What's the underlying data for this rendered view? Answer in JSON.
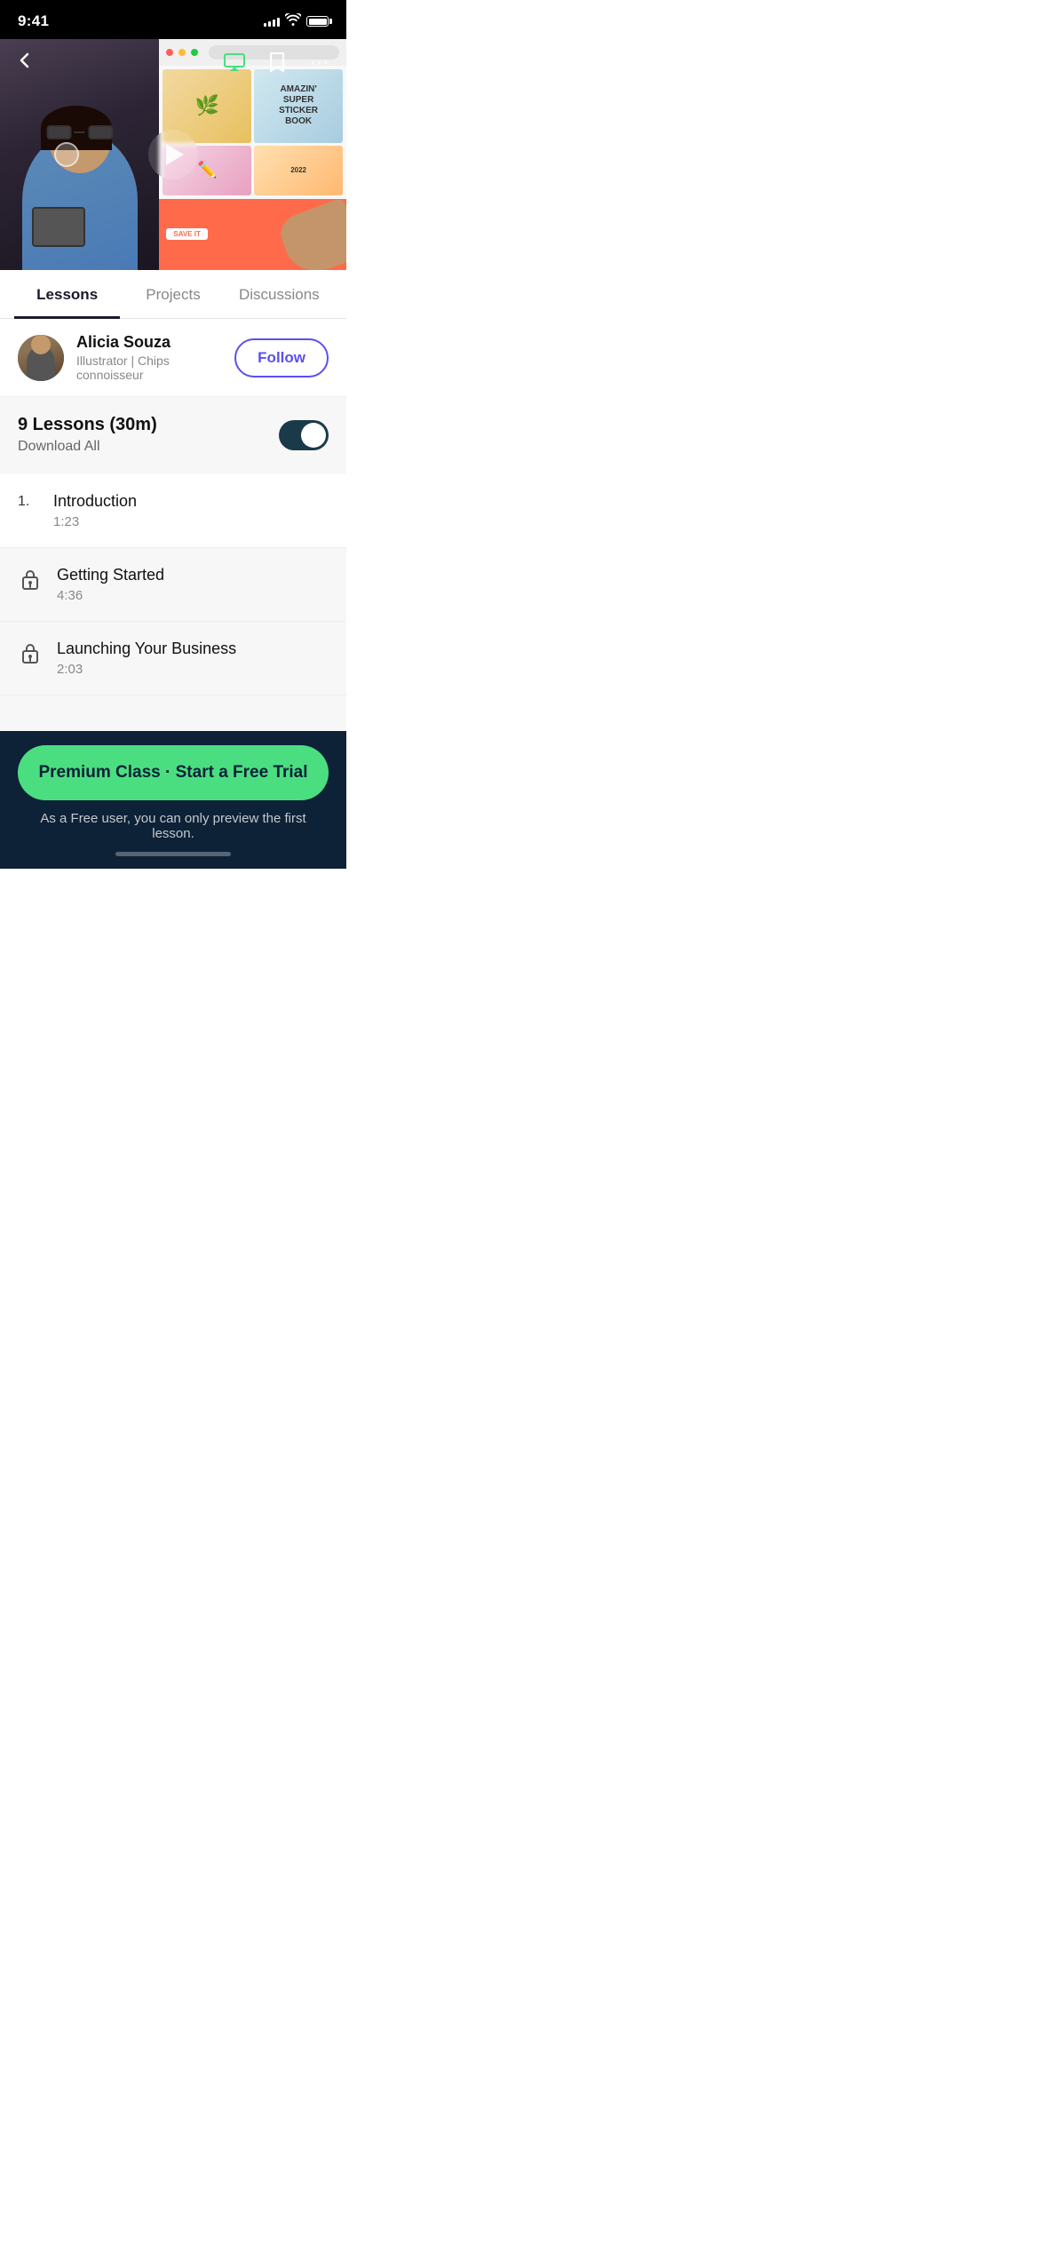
{
  "statusBar": {
    "time": "9:41",
    "signalBars": [
      4,
      6,
      8,
      10,
      12
    ],
    "wifi": "wifi",
    "battery": "battery"
  },
  "videoSection": {
    "airplayLabel": "airplay-icon",
    "bookmarkLabel": "bookmark-icon",
    "moreLabel": "more-icon",
    "backLabel": "back-icon"
  },
  "tabs": [
    {
      "label": "Lessons",
      "active": true
    },
    {
      "label": "Projects",
      "active": false
    },
    {
      "label": "Discussions",
      "active": false
    }
  ],
  "instructor": {
    "name": "Alicia Souza",
    "title": "Illustrator | Chips connoisseur",
    "followLabel": "Follow"
  },
  "lessonsSection": {
    "title": "9 Lessons (30m)",
    "downloadAll": "Download All"
  },
  "lessons": [
    {
      "number": "1.",
      "name": "Introduction",
      "duration": "1:23",
      "locked": false
    },
    {
      "number": "",
      "name": "Getting Started",
      "duration": "4:36",
      "locked": true
    },
    {
      "number": "",
      "name": "Launching Your Business",
      "duration": "2:03",
      "locked": true
    }
  ],
  "cta": {
    "buttonLabel": "Premium Class · Start a Free Trial",
    "subtitle": "As a Free user, you can only preview the first lesson."
  }
}
